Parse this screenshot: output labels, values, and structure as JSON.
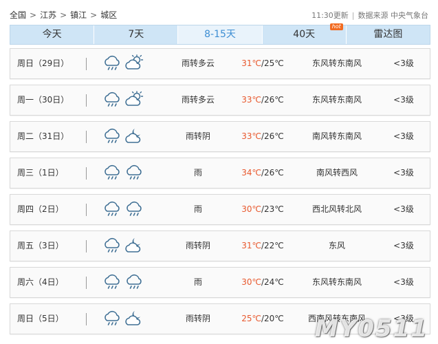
{
  "breadcrumb": {
    "items": [
      "全国",
      "江苏",
      "镇江",
      "城区"
    ],
    "separator": ">"
  },
  "meta": {
    "update_time": "11:30更新",
    "source": "数据来源 中央气象台"
  },
  "tabs": [
    {
      "label": "今天",
      "active": false
    },
    {
      "label": "7天",
      "active": false
    },
    {
      "label": "8-15天",
      "active": true
    },
    {
      "label": "40天",
      "active": false,
      "badge": "hot"
    },
    {
      "label": "雷达图",
      "active": false
    }
  ],
  "colors": {
    "accent": "#3d8ed3",
    "temp_high": "#e8582d",
    "tab_bg": "#cfe5f6",
    "tab_active_bg": "#e9f3fb",
    "badge": "#f26b21"
  },
  "forecast": [
    {
      "day": "周日（29日）",
      "icons": [
        "rain-icon",
        "partly-cloudy-icon"
      ],
      "desc": "雨转多云",
      "high": "31℃",
      "low": "/25℃",
      "wind": "东风转东南风",
      "level": "<3级"
    },
    {
      "day": "周一（30日）",
      "icons": [
        "rain-icon",
        "partly-cloudy-icon"
      ],
      "desc": "雨转多云",
      "high": "33℃",
      "low": "/26℃",
      "wind": "东风转东南风",
      "level": "<3级"
    },
    {
      "day": "周二（31日）",
      "icons": [
        "rain-icon",
        "overcast-icon"
      ],
      "desc": "雨转阴",
      "high": "33℃",
      "low": "/26℃",
      "wind": "南风转东南风",
      "level": "<3级"
    },
    {
      "day": "周三（1日）",
      "icons": [
        "rain-icon",
        "rain-icon"
      ],
      "desc": "雨",
      "high": "34℃",
      "low": "/26℃",
      "wind": "南风转西风",
      "level": "<3级"
    },
    {
      "day": "周四（2日）",
      "icons": [
        "rain-icon",
        "rain-icon"
      ],
      "desc": "雨",
      "high": "30℃",
      "low": "/23℃",
      "wind": "西北风转北风",
      "level": "<3级"
    },
    {
      "day": "周五（3日）",
      "icons": [
        "rain-icon",
        "overcast-icon"
      ],
      "desc": "雨转阴",
      "high": "31℃",
      "low": "/22℃",
      "wind": "东风",
      "level": "<3级"
    },
    {
      "day": "周六（4日）",
      "icons": [
        "rain-icon",
        "rain-icon"
      ],
      "desc": "雨",
      "high": "30℃",
      "low": "/24℃",
      "wind": "东风转东南风",
      "level": "<3级"
    },
    {
      "day": "周日（5日）",
      "icons": [
        "rain-icon",
        "overcast-icon"
      ],
      "desc": "雨转阴",
      "high": "25℃",
      "low": "/20℃",
      "wind": "西南风转东南风",
      "level": "<3级"
    }
  ],
  "watermark": "MY0511"
}
